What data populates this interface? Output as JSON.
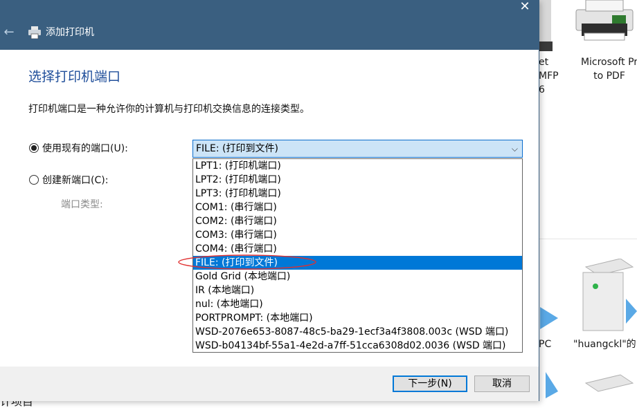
{
  "background": {
    "items": [
      {
        "label_lines": [
          "et",
          "MFP",
          "6"
        ]
      },
      {
        "label_lines": [
          "Microsoft Pr",
          "to PDF"
        ]
      },
      {
        "label_lines": [
          "PC"
        ]
      },
      {
        "label_lines": [
          "\"huangckl\"的"
        ]
      }
    ],
    "bottom_text": "计项目"
  },
  "dialog": {
    "title": "添加打印机",
    "back_icon": "back-arrow-icon",
    "printer_icon": "printer-icon",
    "close_label": "✕",
    "heading": "选择打印机端口",
    "description": "打印机端口是一种允许你的计算机与打印机交换信息的连接类型。",
    "use_existing_label": "使用现有的端口(U):",
    "create_new_label": "创建新端口(C):",
    "port_type_label": "端口类型:",
    "selected_port": "FILE: (打印到文件)",
    "ports": [
      "LPT1: (打印机端口)",
      "LPT2: (打印机端口)",
      "LPT3: (打印机端口)",
      "COM1: (串行端口)",
      "COM2: (串行端口)",
      "COM3: (串行端口)",
      "COM4: (串行端口)",
      "FILE: (打印到文件)",
      "Gold Grid (本地端口)",
      "IR (本地端口)",
      "nul: (本地端口)",
      "PORTPROMPT: (本地端口)",
      "WSD-2076e653-8087-48c5-ba29-1ecf3a4f3808.003c (WSD 端口)",
      "WSD-b04134bf-55a1-4e2d-a7ff-51cca6308d02.0036 (WSD 端口)"
    ],
    "highlighted_index": 7,
    "next_button": "下一步(N)",
    "cancel_button": "取消"
  },
  "colors": {
    "titlebar": "#3a5f80",
    "heading": "#1f4e9a",
    "selection": "#0078d7",
    "annotation": "#e03030"
  }
}
